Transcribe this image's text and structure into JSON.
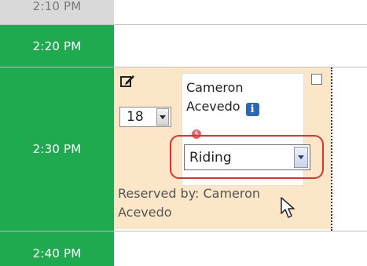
{
  "timeslots": [
    {
      "label": "2:10 PM"
    },
    {
      "label": "2:20 PM"
    },
    {
      "label": "2:30 PM"
    },
    {
      "label": "2:40 PM"
    }
  ],
  "appointment": {
    "seat_count": "18",
    "person_name": "Cameron Acevedo",
    "name_line1": "Cameron",
    "name_line2": "Acevedo",
    "activity_type": "Riding",
    "reserved_by_text": "Reserved by: Cameron Acevedo",
    "icons": {
      "edit": "edit-icon",
      "info": "info-icon",
      "payment": "dollar-icon"
    }
  },
  "colors": {
    "timeslot_green": "#1faa4f",
    "appointment_bg": "#fbe6c8",
    "highlight_red": "#e23030"
  }
}
